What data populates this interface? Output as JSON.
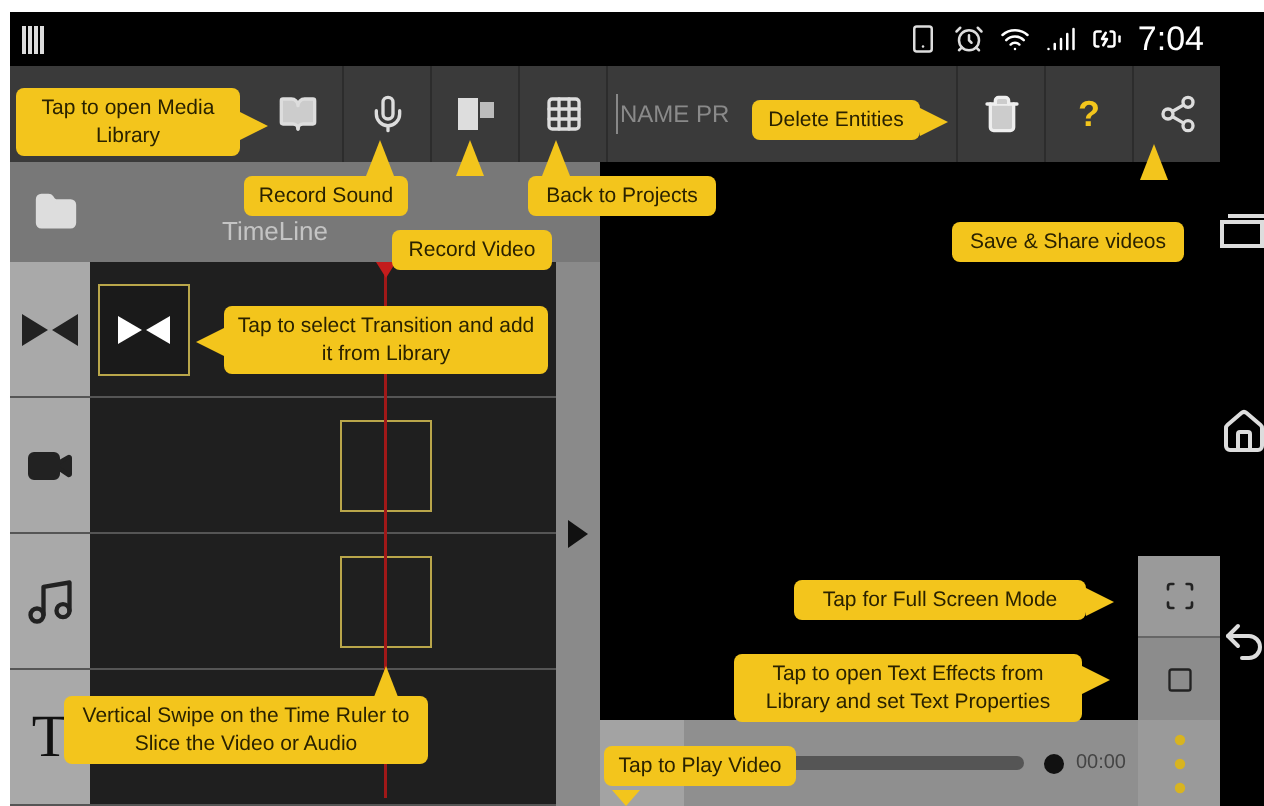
{
  "status_bar": {
    "time": "7:04"
  },
  "toolbar": {
    "name_field": {
      "placeholder": "NAME PR"
    },
    "help": "?"
  },
  "timeline": {
    "title": "TimeLine",
    "tracks": [
      {
        "kind": "transition"
      },
      {
        "kind": "video"
      },
      {
        "kind": "audio"
      },
      {
        "kind": "text",
        "glyph": "T"
      }
    ]
  },
  "player": {
    "time": "00:00"
  },
  "callouts": [
    {
      "text": "Tap to open Media Library"
    },
    {
      "text": "Record Sound"
    },
    {
      "text": "Record Video"
    },
    {
      "text": "Back to Projects"
    },
    {
      "text": "Delete Entities"
    },
    {
      "text": "Save & Share videos"
    },
    {
      "text": "Tap to select Transition and add it from Library"
    },
    {
      "text": "Vertical Swipe on the Time Ruler to Slice the Video or Audio"
    },
    {
      "text": "Tap for Full Screen Mode"
    },
    {
      "text": "Tap to open Text Effects from Library and set Text Properties"
    },
    {
      "text": "Tap to Play Video"
    }
  ]
}
